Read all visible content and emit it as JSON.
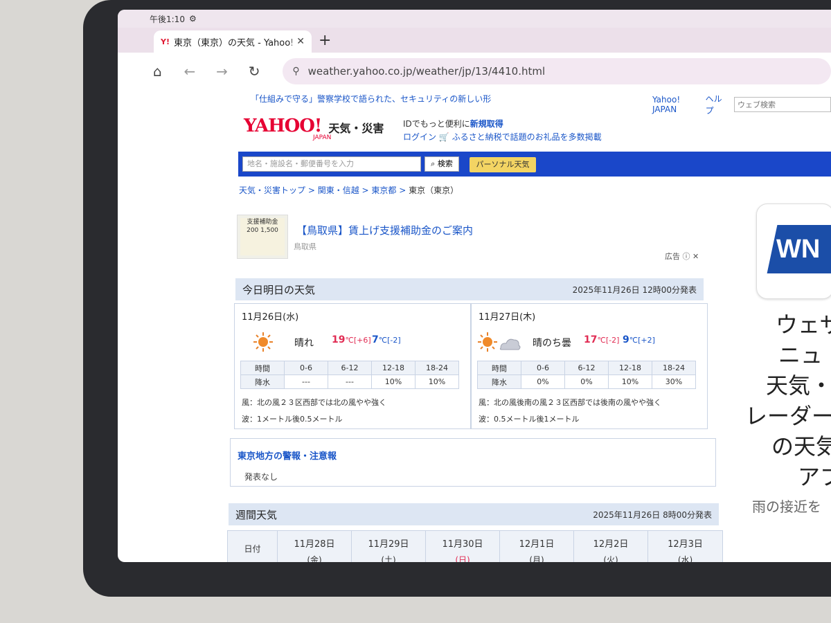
{
  "status": {
    "time": "午後1:10",
    "settings_icon": "gear-icon"
  },
  "browser": {
    "tab_title": "東京（東京）の天気 - Yahoo!",
    "favicon": "Y!",
    "close_label": "✕",
    "new_tab_label": "+",
    "url": "weather.yahoo.co.jp/weather/jp/13/4410.html"
  },
  "header": {
    "promo": "「仕組みで守る」警察学校で語られた、セキュリティの新しい形",
    "links": [
      "Yahoo! JAPAN",
      "ヘルプ"
    ],
    "web_search_placeholder": "ウェブ検索",
    "logo_text": "YAHOO!",
    "logo_sub": "JAPAN",
    "service": "天気・災害",
    "id_text": "IDでもっと便利に",
    "signup": "新規取得",
    "login": "ログイン",
    "furusato": "ふるさと納税で話題のお礼品を多数掲載"
  },
  "searchbar": {
    "placeholder": "地名・施設名・郵便番号を入力",
    "search_label": "検索",
    "personal_label": "パーソナル天気"
  },
  "breadcrumb": [
    "天気・災害トップ",
    "関東・信越",
    "東京都",
    "東京（東京）"
  ],
  "ad": {
    "title": "【鳥取県】賃上げ支援補助金のご案内",
    "sponsor": "鳥取県",
    "label": "広告",
    "image_text": "支援補助金 200 1,500"
  },
  "forecast": {
    "title": "今日明日の天気",
    "issued": "2025年11月26日 12時00分発表",
    "days": [
      {
        "date": "11月26日(水)",
        "weather": "晴れ",
        "high": "19",
        "high_unit": "℃",
        "high_diff": "[+6]",
        "low": "7",
        "low_unit": "℃",
        "low_diff": "[-2]",
        "headers": [
          "時間",
          "0-6",
          "6-12",
          "12-18",
          "18-24"
        ],
        "rain": [
          "降水",
          "---",
          "---",
          "10%",
          "10%"
        ],
        "wind": "風：北の風２３区西部では北の風やや強く",
        "wave": "波：1メートル後0.5メートル"
      },
      {
        "date": "11月27日(木)",
        "weather": "晴のち曇",
        "high": "17",
        "high_unit": "℃",
        "high_diff": "[-2]",
        "low": "9",
        "low_unit": "℃",
        "low_diff": "[+2]",
        "headers": [
          "時間",
          "0-6",
          "6-12",
          "12-18",
          "18-24"
        ],
        "rain": [
          "降水",
          "0%",
          "0%",
          "10%",
          "30%"
        ],
        "wind": "風：北の風後南の風２３区西部では後南の風やや強く",
        "wave": "波：0.5メートル後1メートル"
      }
    ]
  },
  "warning": {
    "title": "東京地方の警報・注意報",
    "text": "発表なし"
  },
  "weekly": {
    "title": "週間天気",
    "issued": "2025年11月26日 8時00分発表",
    "row_label": "日付",
    "dates": [
      {
        "date": "11月28日",
        "wd": "(金)"
      },
      {
        "date": "11月29日",
        "wd": "(土)"
      },
      {
        "date": "11月30日",
        "wd": "(日)"
      },
      {
        "date": "12月1日",
        "wd": "(月)"
      },
      {
        "date": "12月2日",
        "wd": "(火)"
      },
      {
        "date": "12月3日",
        "wd": "(水)"
      }
    ]
  },
  "side": {
    "logo": "WN",
    "lines": [
      "ウェザ",
      "ニュ",
      "天気・",
      "レーダー",
      "の天気",
      "アプ"
    ],
    "sub": "雨の接近を"
  },
  "colors": {
    "accent": "#1a47c9",
    "high": "#e12c53",
    "low": "#1a56c8",
    "section": "#dde6f3"
  }
}
